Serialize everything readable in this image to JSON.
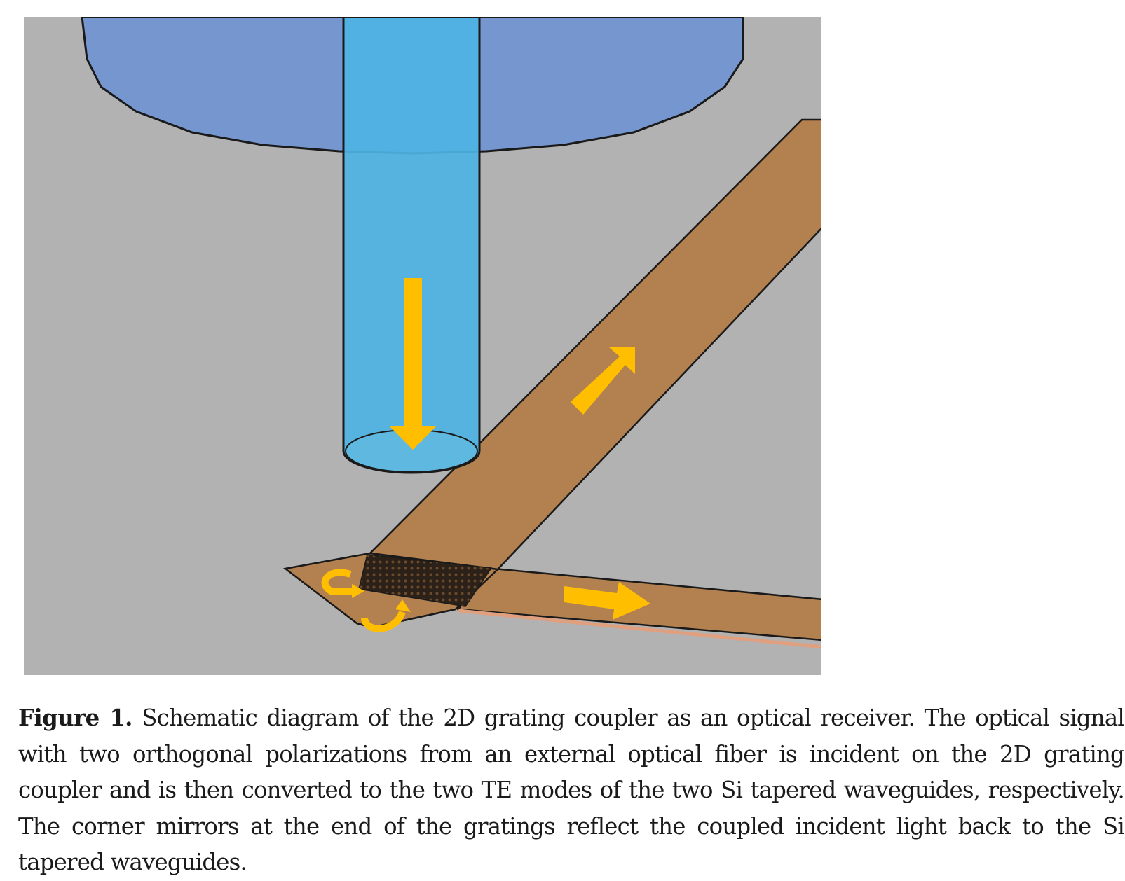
{
  "figure": {
    "label": "Figure 1.",
    "caption": "Schematic diagram of the 2D grating coupler as an optical receiver. The optical signal with two orthogonal polarizations from an external optical fiber is incident on the 2D grating coupler and is then converted to the two TE modes of the two Si tapered waveguides, respectively. The corner mirrors at the end of the gratings reflect the coupled incident light back to the Si tapered waveguides."
  },
  "colors": {
    "background": "#b2b2b2",
    "fiber_housing": "#7596cf",
    "fiber_core": "#4fb3e3",
    "waveguide": "#b38150",
    "grating": "#2b2118",
    "arrow": "#ffbf00"
  }
}
